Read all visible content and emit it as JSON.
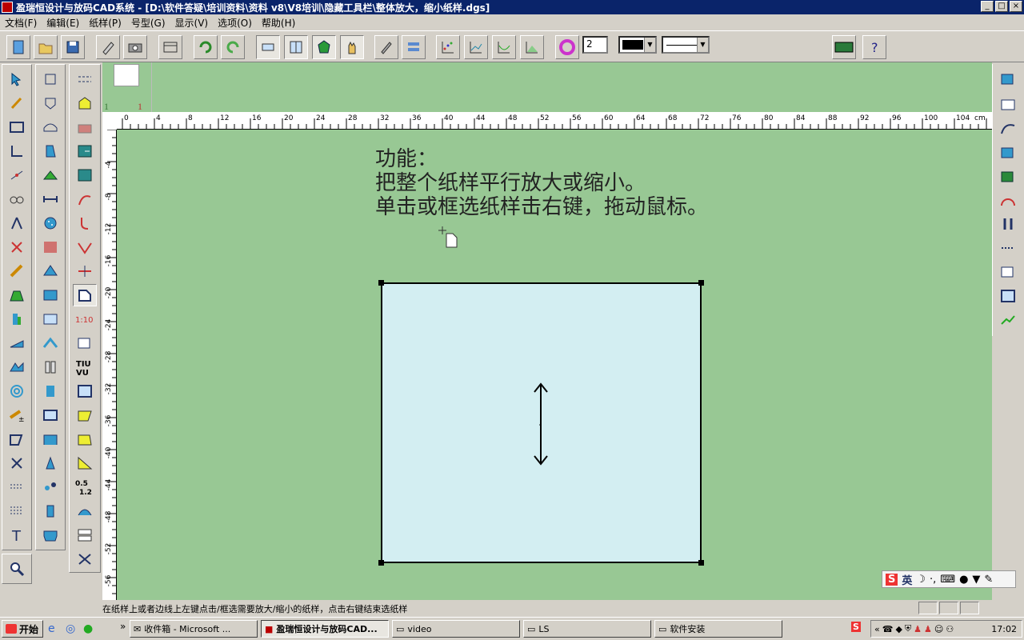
{
  "window": {
    "title": "盈瑞恒设计与放码CAD系统 - [D:\\软件答疑\\培训资料\\资料 v8\\V8培训\\隐藏工具栏\\整体放大，缩小纸样.dgs]",
    "min_label": "_",
    "max_label": "□",
    "close_label": "×"
  },
  "menu": {
    "items": [
      "文档(F)",
      "编辑(E)",
      "纸样(P)",
      "号型(G)",
      "显示(V)",
      "选项(O)",
      "帮助(H)"
    ]
  },
  "toolbar": {
    "line_width": "2",
    "stroke_color": "#000000",
    "icons": [
      "new-file-icon",
      "open-folder-icon",
      "save-icon",
      "pencil-icon",
      "camera-icon",
      "table-icon",
      "undo-icon",
      "redo-icon",
      "pattern-dim-icon",
      "grid-pattern-icon",
      "green-gem-icon",
      "hand-icon",
      "brush-icon",
      "layers-icon",
      "scatter-icon",
      "grade-chart-icon",
      "curve-chart-icon",
      "gradient-chart-icon",
      "color-wheel-icon",
      "film-icon",
      "help-icon"
    ]
  },
  "thumbnails": {
    "left_label": "1",
    "right_label": "1"
  },
  "ruler": {
    "unit": "cm",
    "h_labels": [
      "0",
      "4",
      "8",
      "12",
      "16",
      "20",
      "24",
      "28",
      "32",
      "36",
      "40",
      "44",
      "48",
      "52",
      "56",
      "60",
      "64",
      "68",
      "72",
      "76",
      "80",
      "84",
      "88",
      "92",
      "96",
      "100",
      "104"
    ],
    "v_labels": [
      "0",
      "4",
      "8",
      "12",
      "16",
      "20",
      "24",
      "28",
      "32",
      "36",
      "40",
      "44",
      "48",
      "52",
      "56"
    ]
  },
  "canvas": {
    "line1": "功能：",
    "line2": "把整个纸样平行放大或缩小。",
    "line3": "单击或框选纸样击右键，拖动鼠标。",
    "paper_color": "#d3eef2",
    "workspace_color": "#98c894"
  },
  "status": {
    "text": "在纸样上或者边线上左键点击/框选需要放大/缩小的纸样，点击右键结束选纸样"
  },
  "ime": {
    "logo": "S",
    "mode": "英"
  },
  "taskbar": {
    "start_label": "开始",
    "tasks": [
      "收件箱 - Microsoft ...",
      "盈瑞恒设计与放码CAD...",
      "video",
      "LS",
      "软件安装"
    ],
    "clock": "17:02",
    "chevron": "«"
  }
}
